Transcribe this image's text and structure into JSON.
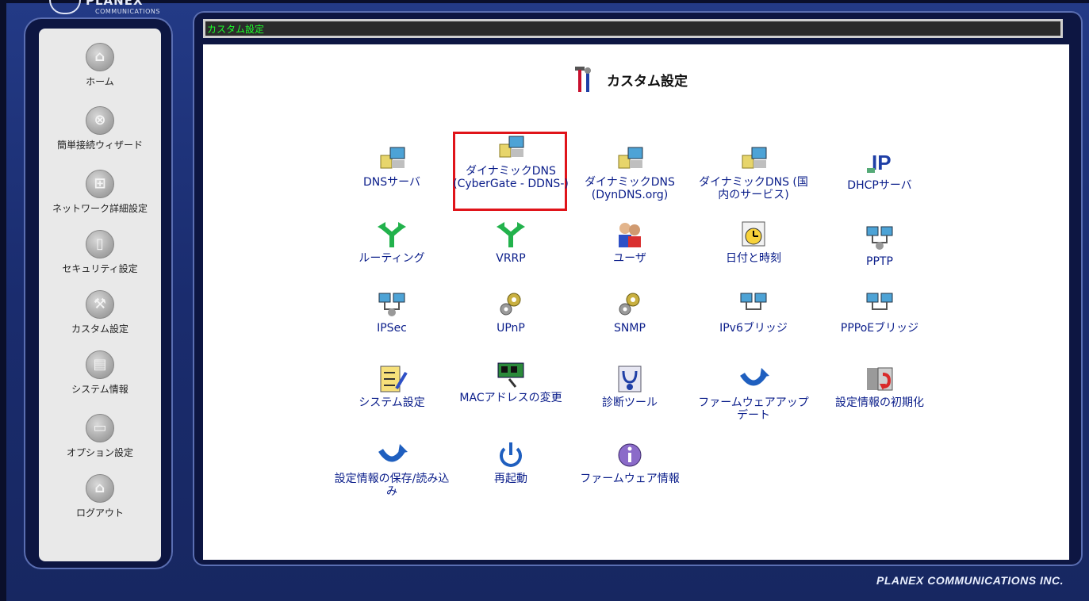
{
  "brand": {
    "name": "PLANEX",
    "sub": "COMMUNICATIONS",
    "footer": "PLANEX COMMUNICATIONS INC."
  },
  "sidebar": {
    "items": [
      {
        "label": "ホーム",
        "icon": "home-icon"
      },
      {
        "label": "簡単接続ウィザード",
        "icon": "wizard-icon"
      },
      {
        "label": "ネットワーク詳細設定",
        "icon": "network-icon"
      },
      {
        "label": "セキュリティ設定",
        "icon": "lock-icon"
      },
      {
        "label": "カスタム設定",
        "icon": "tools-icon"
      },
      {
        "label": "システム情報",
        "icon": "info-sheet-icon"
      },
      {
        "label": "オプション設定",
        "icon": "option-icon"
      },
      {
        "label": "ログアウト",
        "icon": "logout-icon"
      }
    ]
  },
  "titlebar": {
    "text": "カスタム設定"
  },
  "main": {
    "heading": "カスタム設定",
    "items": [
      {
        "label": "DNSサーバ",
        "icon": "server-computer-icon"
      },
      {
        "label": "ダイナミックDNS (CyberGate - DDNS-)",
        "icon": "server-computer-icon"
      },
      {
        "label": "ダイナミックDNS (DynDNS.org)",
        "icon": "server-computer-icon"
      },
      {
        "label": "ダイナミックDNS (国内のサービス)",
        "icon": "server-computer-icon"
      },
      {
        "label": "DHCPサーバ",
        "icon": "ip-icon"
      },
      {
        "label": "ルーティング",
        "icon": "routing-arrow-icon"
      },
      {
        "label": "VRRP",
        "icon": "routing-arrow-icon"
      },
      {
        "label": "ユーザ",
        "icon": "users-icon"
      },
      {
        "label": "日付と時刻",
        "icon": "calendar-clock-icon"
      },
      {
        "label": "PPTP",
        "icon": "network-pc-icon"
      },
      {
        "label": "IPSec",
        "icon": "network-pc-icon"
      },
      {
        "label": "UPnP",
        "icon": "gears-icon"
      },
      {
        "label": "SNMP",
        "icon": "gears-icon"
      },
      {
        "label": "IPv6ブリッジ",
        "icon": "network-pc-icon"
      },
      {
        "label": "PPPoEブリッジ",
        "icon": "network-pc-icon"
      },
      {
        "label": "システム設定",
        "icon": "checklist-icon"
      },
      {
        "label": "MACアドレスの変更",
        "icon": "nic-card-icon"
      },
      {
        "label": "診断ツール",
        "icon": "stethoscope-icon"
      },
      {
        "label": "ファームウェアアップデート",
        "icon": "refresh-arrow-icon"
      },
      {
        "label": "設定情報の初期化",
        "icon": "reset-icon"
      },
      {
        "label": "設定情報の保存/読み込み",
        "icon": "refresh-arrow-icon"
      },
      {
        "label": "再起動",
        "icon": "power-icon"
      },
      {
        "label": "ファームウェア情報",
        "icon": "info-icon"
      }
    ]
  }
}
